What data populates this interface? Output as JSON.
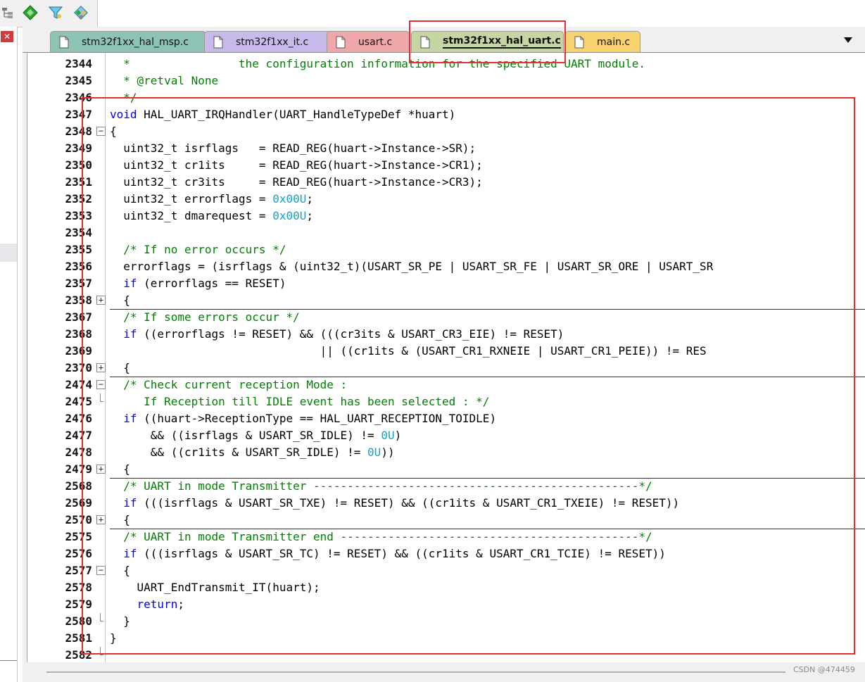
{
  "toolbar": {
    "icons": [
      "tree-view-icon",
      "green-diamond-icon",
      "filter-icon",
      "multi-diamond-icon"
    ]
  },
  "tabs": [
    {
      "label": "stm32f1xx_hal_msp.c",
      "color": "#8cc3b4",
      "active": false
    },
    {
      "label": "stm32f1xx_it.c",
      "color": "#c7b9ea",
      "active": false
    },
    {
      "label": "usart.c",
      "color": "#f0a7aa",
      "active": false
    },
    {
      "label": "stm32f1xx_hal_uart.c",
      "color": "#c5d6a2",
      "active": true
    },
    {
      "label": "main.c",
      "color": "#f7d26e",
      "active": false
    }
  ],
  "code": {
    "lines": [
      {
        "n": "2344",
        "text": "  *                the configuration information for the specified UART module."
      },
      {
        "n": "2345",
        "text": "  * @retval None"
      },
      {
        "n": "2346",
        "text": "  */"
      },
      {
        "n": "2347",
        "text": "void HAL_UART_IRQHandler(UART_HandleTypeDef *huart)"
      },
      {
        "n": "2348",
        "text": "{"
      },
      {
        "n": "2349",
        "text": "  uint32_t isrflags   = READ_REG(huart->Instance->SR);"
      },
      {
        "n": "2350",
        "text": "  uint32_t cr1its     = READ_REG(huart->Instance->CR1);"
      },
      {
        "n": "2351",
        "text": "  uint32_t cr3its     = READ_REG(huart->Instance->CR3);"
      },
      {
        "n": "2352",
        "text": "  uint32_t errorflags = 0x00U;"
      },
      {
        "n": "2353",
        "text": "  uint32_t dmarequest = 0x00U;"
      },
      {
        "n": "2354",
        "text": ""
      },
      {
        "n": "2355",
        "text": "  /* If no error occurs */"
      },
      {
        "n": "2356",
        "text": "  errorflags = (isrflags & (uint32_t)(USART_SR_PE | USART_SR_FE | USART_SR_ORE | USART_SR"
      },
      {
        "n": "2357",
        "text": "  if (errorflags == RESET)"
      },
      {
        "n": "2358",
        "text": "  {"
      },
      {
        "n": "2367",
        "text": "  /* If some errors occur */"
      },
      {
        "n": "2368",
        "text": "  if ((errorflags != RESET) && (((cr3its & USART_CR3_EIE) != RESET)"
      },
      {
        "n": "2369",
        "text": "                               || ((cr1its & (USART_CR1_RXNEIE | USART_CR1_PEIE)) != RES"
      },
      {
        "n": "2370",
        "text": "  {"
      },
      {
        "n": "2474",
        "text": "  /* Check current reception Mode :"
      },
      {
        "n": "2475",
        "text": "     If Reception till IDLE event has been selected : */"
      },
      {
        "n": "2476",
        "text": "  if ((huart->ReceptionType == HAL_UART_RECEPTION_TOIDLE)"
      },
      {
        "n": "2477",
        "text": "      && ((isrflags & USART_SR_IDLE) != 0U)"
      },
      {
        "n": "2478",
        "text": "      && ((cr1its & USART_SR_IDLE) != 0U))"
      },
      {
        "n": "2479",
        "text": "  {"
      },
      {
        "n": "2568",
        "text": "  /* UART in mode Transmitter ------------------------------------------------*/"
      },
      {
        "n": "2569",
        "text": "  if (((isrflags & USART_SR_TXE) != RESET) && ((cr1its & USART_CR1_TXEIE) != RESET))"
      },
      {
        "n": "2570",
        "text": "  {"
      },
      {
        "n": "2575",
        "text": "  /* UART in mode Transmitter end --------------------------------------------*/"
      },
      {
        "n": "2576",
        "text": "  if (((isrflags & USART_SR_TC) != RESET) && ((cr1its & USART_CR1_TCIE) != RESET))"
      },
      {
        "n": "2577",
        "text": "  {"
      },
      {
        "n": "2578",
        "text": "    UART_EndTransmit_IT(huart);"
      },
      {
        "n": "2579",
        "text": "    return;"
      },
      {
        "n": "2580",
        "text": "  }"
      },
      {
        "n": "2581",
        "text": "}"
      },
      {
        "n": "2582",
        "text": ""
      }
    ]
  },
  "watermark": "CSDN @474459",
  "colors": {
    "keyword": "#0000ff",
    "comment": "#008000",
    "number": "#18a0c8",
    "highlight_box": "#e03030"
  }
}
